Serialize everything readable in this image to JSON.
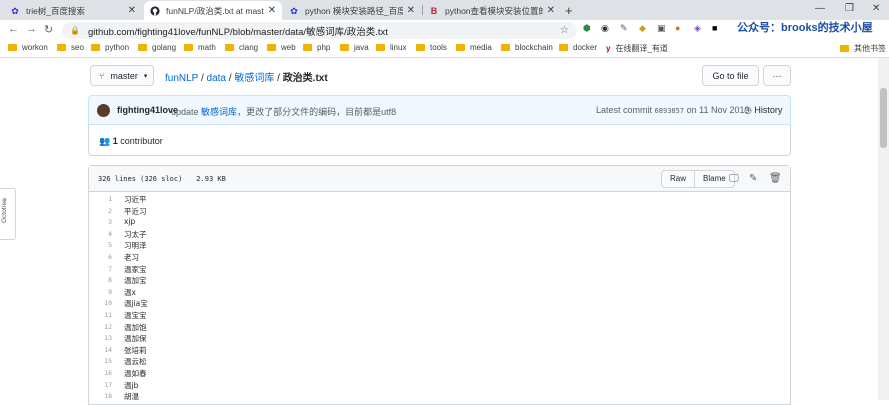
{
  "browser": {
    "tabs": [
      {
        "title": "trie树_百度搜索",
        "icon": "baidu-icon"
      },
      {
        "title": "funNLP/政治类.txt at master · f",
        "icon": "github-icon"
      },
      {
        "title": "python 模块安装路径_百度搜索",
        "icon": "baidu-icon"
      },
      {
        "title": "python查看模块安装位置的方法",
        "icon": "csdn-icon"
      }
    ],
    "url": "github.com/fighting41love/funNLP/blob/master/data/敏感词库/政治类.txt",
    "bookmarks": [
      "workon",
      "seo",
      "python",
      "golang",
      "math",
      "clang",
      "web",
      "php",
      "java",
      "linux",
      "tools",
      "media",
      "blockchain",
      "docker",
      "在线翻译_有道",
      "其他书签"
    ],
    "watermark": "公众号：brooks的技术小屋"
  },
  "octotree": {
    "label": "Octotree"
  },
  "repo": {
    "branch": "master",
    "breadcrumb": {
      "root": "funNLP",
      "sep": "/",
      "dir1": "data",
      "dir2": "敏感词库",
      "file": "政治类.txt"
    },
    "go_to_file": "Go to file",
    "more": "···"
  },
  "commit": {
    "author": "fighting41love",
    "message_prefix": "update",
    "message_link": "敏感词库",
    "message_rest": "，更改了部分文件的编码，目前都是utf8",
    "latest_label": "Latest commit",
    "hash": "6893857",
    "on_label": "on",
    "date": "11 Nov 2019",
    "history": "History"
  },
  "contributors": {
    "count": "1",
    "label": "contributor"
  },
  "file": {
    "info": "326 lines (326 sloc)",
    "size": "2.93 KB",
    "raw": "Raw",
    "blame": "Blame",
    "lines": [
      "习近平",
      "平近习",
      "xjp",
      "习太子",
      "习明泽",
      "老习",
      "温家宝",
      "温加宝",
      "温x",
      "温jia宝",
      "温宝宝",
      "温加饱",
      "温加保",
      "张培莉",
      "温云松",
      "温如春",
      "温jb",
      "胡温"
    ]
  },
  "colors": {
    "link": "#0366d6",
    "commit_bg": "#f1f8ff",
    "tab_bar": "#dee1e6"
  }
}
